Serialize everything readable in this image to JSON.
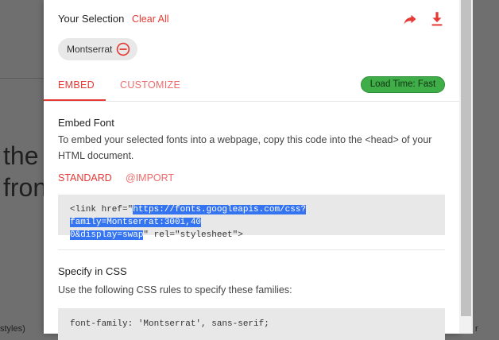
{
  "background": {
    "heading_line1": "the",
    "heading_line2": "fron",
    "bottom_left": "styles)",
    "bottom_right": "r"
  },
  "selection": {
    "title": "Your Selection",
    "clear_all": "Clear All",
    "chip_label": "Montserrat"
  },
  "tabs": {
    "embed": "EMBED",
    "customize": "CUSTOMIZE",
    "load_time": "Load Time: Fast"
  },
  "embed": {
    "title": "Embed Font",
    "description": "To embed your selected fonts into a webpage, copy this code into the <head> of your HTML document.",
    "sub_tabs": {
      "standard": "STANDARD",
      "import": "@IMPORT"
    },
    "code_prefix": "<link href=\"",
    "code_url_line1": "https://fonts.googleapis.com/css?family=Montserrat:300i,40",
    "code_url_line2": "0&display=swap",
    "code_suffix": "\" rel=\"stylesheet\">"
  },
  "css": {
    "title": "Specify in CSS",
    "description": "Use the following CSS rules to specify these families:",
    "code": "font-family: 'Montserrat', sans-serif;"
  },
  "colors": {
    "accent": "#e53935",
    "badge": "#3fae49",
    "highlight": "#3574f0"
  }
}
